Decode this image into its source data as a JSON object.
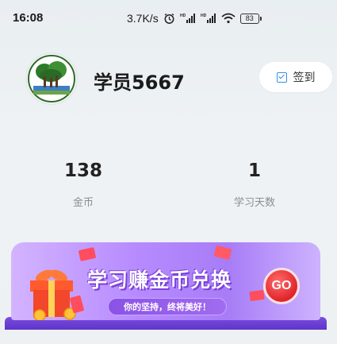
{
  "status_bar": {
    "time": "16:08",
    "net_speed": "3.7K/s",
    "battery": "83"
  },
  "profile": {
    "username": "学员5667",
    "checkin_label": "签到"
  },
  "stats": {
    "coins_value": "138",
    "coins_label": "金币",
    "days_value": "1",
    "days_label": "学习天数"
  },
  "banner": {
    "title": "学习赚金币兑换",
    "subtitle": "你的坚持，终将美好！",
    "go_label": "GO"
  },
  "colors": {
    "accent_purple": "#a77cf6",
    "go_red": "#e1242b",
    "checkin_blue": "#3a8ee0"
  }
}
